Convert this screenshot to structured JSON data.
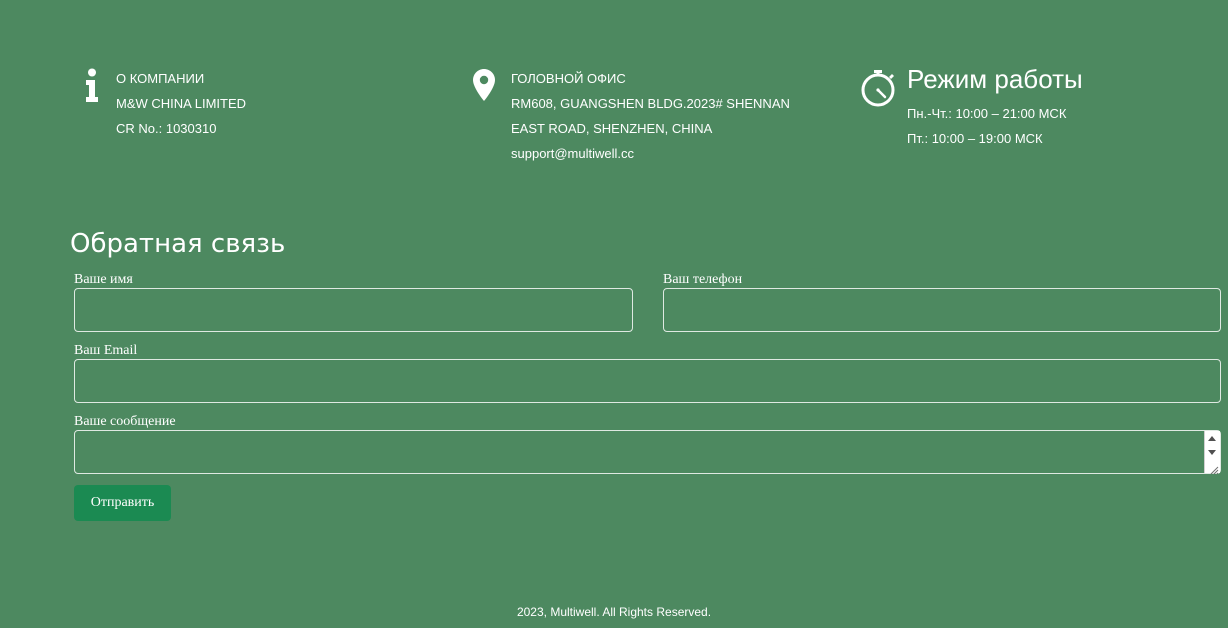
{
  "company": {
    "icon": "info-icon",
    "lines": [
      "О КОМПАНИИ",
      "M&W CHINA LIMITED",
      "CR No.: 1030310"
    ]
  },
  "office": {
    "icon": "location-pin-icon",
    "lines": [
      "ГОЛОВНОЙ ОФИС",
      "RM608, GUANGSHEN BLDG.2023# SHENNAN",
      "EAST ROAD, SHENZHEN, CHINA",
      "support@multiwell.cc"
    ]
  },
  "hours": {
    "icon": "stopwatch-icon",
    "title": "Режим работы",
    "lines": [
      "Пн.-Чт.: 10:00 – 21:00 МСК",
      "Пт.: 10:00 – 19:00 МСК"
    ]
  },
  "form": {
    "title": "Обратная связь",
    "name_label": "Ваше имя",
    "name_value": "",
    "phone_label": "Ваш телефон",
    "phone_value": "",
    "email_label": "Ваш Email",
    "email_value": "",
    "message_label": "Ваше сообщение",
    "message_value": "",
    "submit_label": "Отправить"
  },
  "footer": {
    "text": "2023, Multiwell. All Rights Reserved."
  },
  "colors": {
    "background": "#4d8960",
    "button": "#1b8a52",
    "text": "#ffffff"
  }
}
